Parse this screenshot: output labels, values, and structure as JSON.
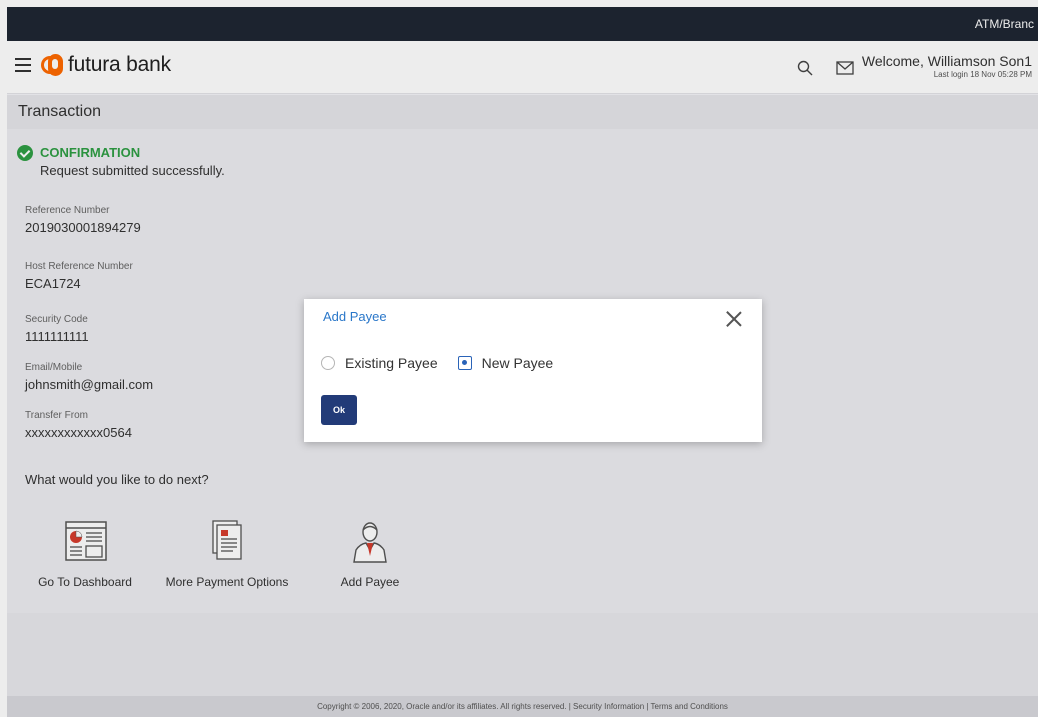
{
  "topbar": {
    "atm_label": "ATM/Branc"
  },
  "header": {
    "brand": "futura bank",
    "welcome": "Welcome, Williamson Son1",
    "last_login": "Last login 18 Nov 05:28 PM",
    "icons": [
      "menu-icon",
      "search-icon",
      "mail-icon"
    ]
  },
  "page": {
    "title": "Transaction"
  },
  "confirmation": {
    "title": "CONFIRMATION",
    "message": "Request submitted successfully.",
    "color": "#2f9e44"
  },
  "details": [
    {
      "label": "Reference Number",
      "value": "2019030001894279"
    },
    {
      "label": "Host Reference Number",
      "value": "ECA1724"
    },
    {
      "label": "Security Code",
      "value": "1111111111"
    },
    {
      "label": "Email/Mobile",
      "value": "johnsmith@gmail.com"
    },
    {
      "label": "Transfer From",
      "value": "xxxxxxxxxxxx0564"
    }
  ],
  "next": {
    "title": "What would you like to do next?",
    "actions": [
      {
        "label": "Go To Dashboard",
        "icon": "dashboard-icon"
      },
      {
        "label": "More Payment Options",
        "icon": "document-icon"
      },
      {
        "label": "Add Payee",
        "icon": "user-icon"
      }
    ]
  },
  "footer": {
    "text": "Copyright © 2006, 2020, Oracle and/or its affiliates. All rights reserved. | Security Information | Terms and Conditions"
  },
  "modal": {
    "title": "Add Payee",
    "options": [
      {
        "label": "Existing Payee",
        "selected": false
      },
      {
        "label": "New Payee",
        "selected": true
      }
    ],
    "ok_label": "Ok",
    "accent": "#2a77c9",
    "button_color": "#223b78"
  }
}
